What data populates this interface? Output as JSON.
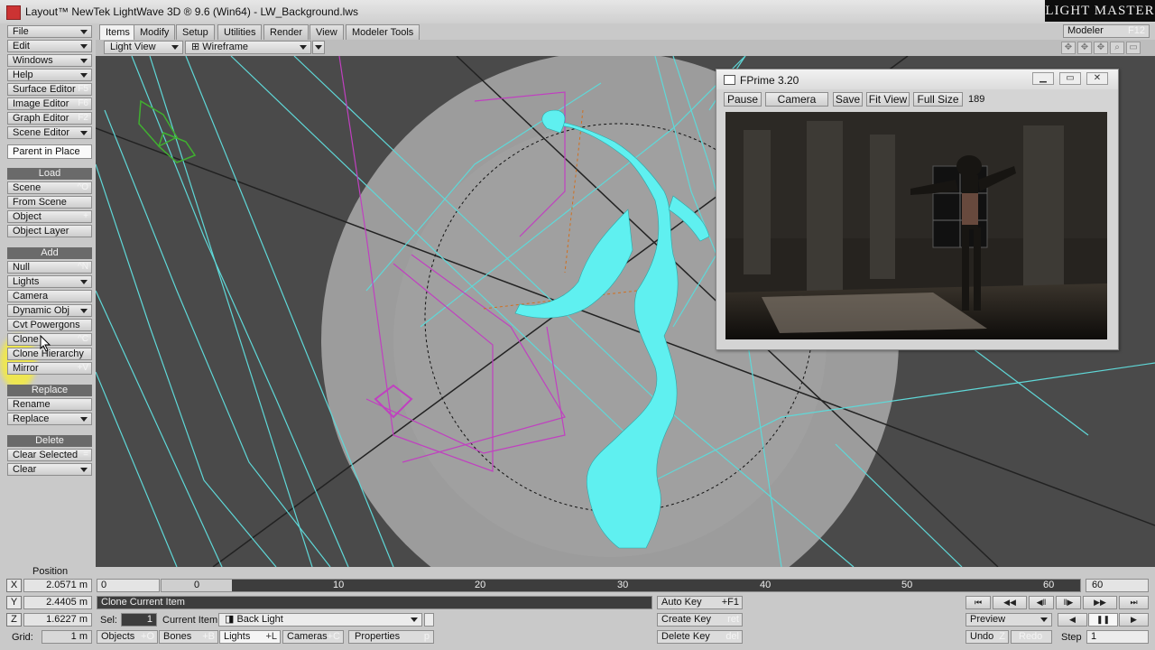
{
  "window": {
    "title": "Layout™ NewTek LightWave 3D ® 9.6  (Win64) - LW_Background.lws",
    "brand": "LIGHT MASTER"
  },
  "menus": [
    {
      "label": "File",
      "dropdown": true
    },
    {
      "label": "Edit",
      "dropdown": true
    },
    {
      "label": "Windows",
      "dropdown": true
    },
    {
      "label": "Help",
      "dropdown": true
    },
    {
      "label": "Surface Editor",
      "shortcut": "F5"
    },
    {
      "label": "Image Editor",
      "shortcut": "F6"
    },
    {
      "label": "Graph Editor",
      "shortcut": "F2"
    },
    {
      "label": "Scene Editor",
      "dropdown": true
    }
  ],
  "parent_in_place": "Parent in Place",
  "load": {
    "header": "Load",
    "items": [
      {
        "label": "Scene",
        "shortcut": "^O"
      },
      {
        "label": "From Scene",
        "shortcut": ""
      },
      {
        "label": "Object",
        "shortcut": "+"
      },
      {
        "label": "Object Layer",
        "shortcut": ""
      }
    ]
  },
  "add": {
    "header": "Add",
    "items": [
      {
        "label": "Null",
        "shortcut": "^N"
      },
      {
        "label": "Lights",
        "dropdown": true
      },
      {
        "label": "Camera",
        "shortcut": ""
      },
      {
        "label": "Dynamic Obj",
        "dropdown": true
      },
      {
        "label": "Cvt Powergons",
        "shortcut": ""
      },
      {
        "label": "Clone",
        "shortcut": "^C"
      },
      {
        "label": "Clone Hierarchy",
        "shortcut": ""
      },
      {
        "label": "Mirror",
        "shortcut": "+V"
      }
    ]
  },
  "replace": {
    "header": "Replace",
    "items": [
      {
        "label": "Rename",
        "shortcut": ""
      },
      {
        "label": "Replace",
        "dropdown": true
      }
    ]
  },
  "delete": {
    "header": "Delete",
    "items": [
      {
        "label": "Clear Selected",
        "shortcut": "="
      },
      {
        "label": "Clear",
        "dropdown": true
      }
    ]
  },
  "tabs": [
    "Items",
    "Modify",
    "Setup",
    "Utilities",
    "Render",
    "View",
    "Modeler Tools"
  ],
  "modeler": {
    "label": "Modeler",
    "shortcut": "F12"
  },
  "viewport_bar": {
    "view": "Light View",
    "mode": "Wireframe"
  },
  "fprime": {
    "title": "FPrime 3.20",
    "buttons": [
      "Pause",
      "Camera",
      "Save",
      "Fit View",
      "Full Size"
    ],
    "count": "189"
  },
  "position": {
    "label": "Position",
    "axes": [
      {
        "axis": "X",
        "value": "2.0571 m"
      },
      {
        "axis": "Y",
        "value": "2.4405 m"
      },
      {
        "axis": "Z",
        "value": "1.6227 m"
      }
    ],
    "grid_label": "Grid:",
    "grid_value": "1 m"
  },
  "timeline": {
    "start": "0",
    "current": "0",
    "ticks": [
      "10",
      "20",
      "30",
      "40",
      "50",
      "60"
    ],
    "end": "60"
  },
  "status": "Clone Current Item",
  "sel": {
    "label": "Sel:",
    "value": "1"
  },
  "current_item": {
    "label": "Current Item",
    "value": "Back Light"
  },
  "filters": [
    {
      "label": "Objects",
      "shortcut": "+O"
    },
    {
      "label": "Bones",
      "shortcut": "+B"
    },
    {
      "label": "Lights",
      "shortcut": "+L"
    },
    {
      "label": "Cameras",
      "shortcut": "+C"
    }
  ],
  "properties": {
    "label": "Properties",
    "shortcut": "p"
  },
  "keys": [
    {
      "label": "Auto Key",
      "shortcut": "+F1"
    },
    {
      "label": "Create Key",
      "shortcut": "ret"
    },
    {
      "label": "Delete Key",
      "shortcut": "del"
    }
  ],
  "preview": "Preview",
  "undo": {
    "label": "Undo",
    "shortcut": "Z"
  },
  "redo": "Redo",
  "step": {
    "label": "Step",
    "value": "1"
  },
  "colors": {
    "wire_cyan": "#5fd8d8",
    "wire_magenta": "#c040c0",
    "silhouette": "#5ff0f0",
    "light_green": "#40b030",
    "highlight": "#f5eb3c"
  }
}
